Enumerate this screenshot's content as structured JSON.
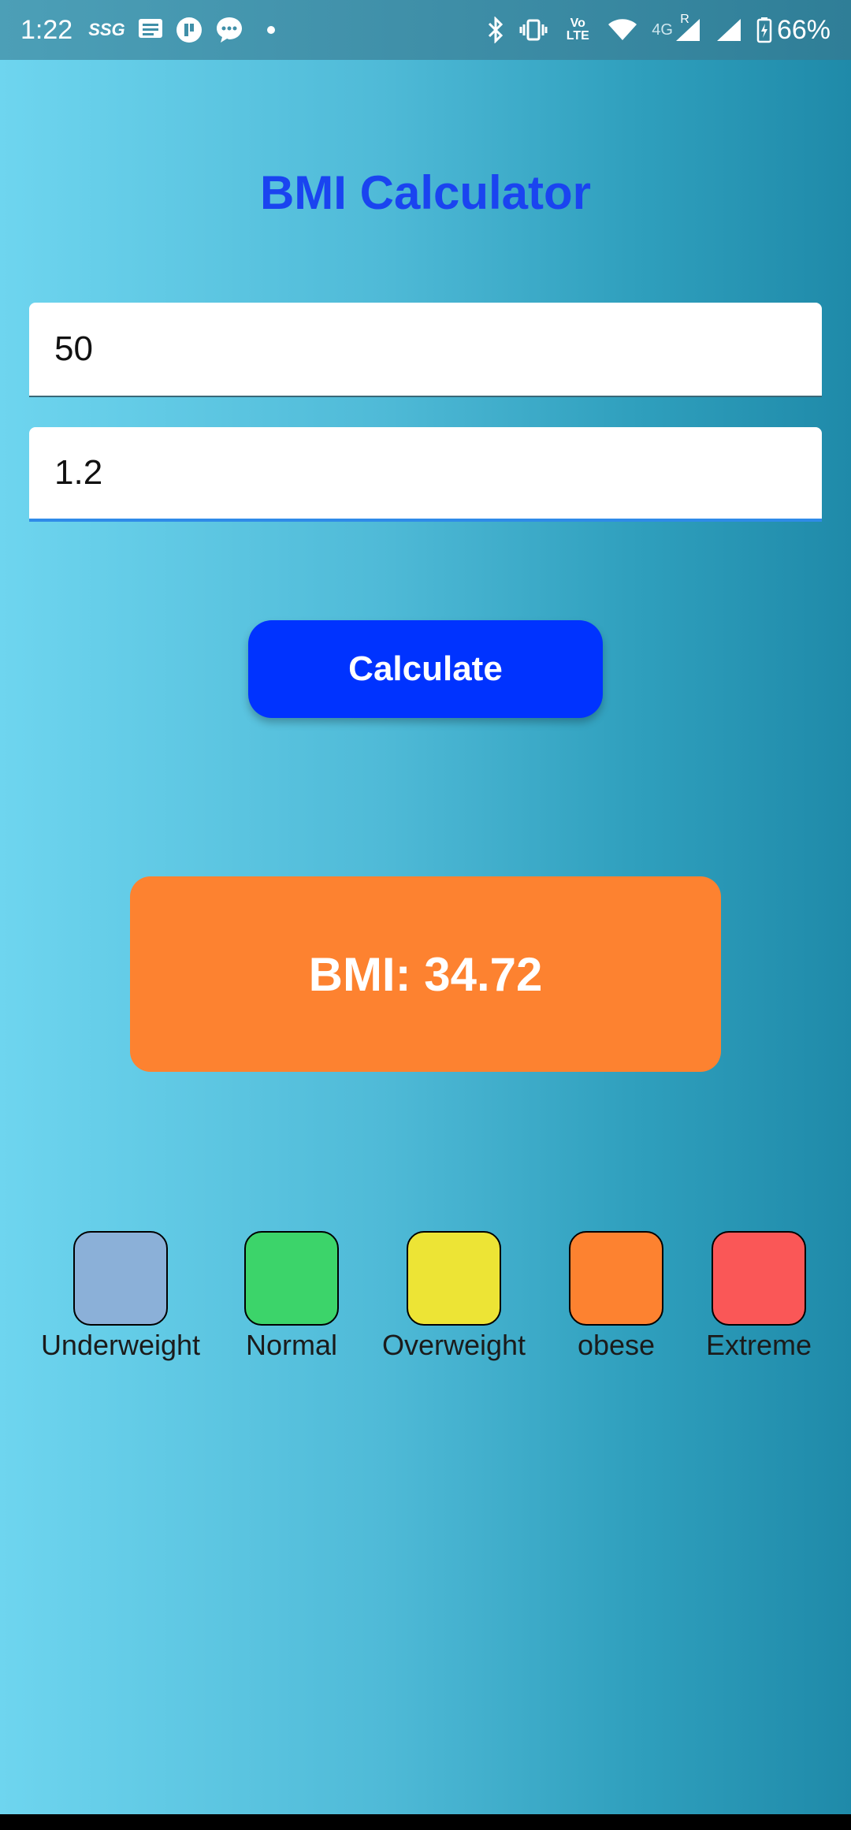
{
  "status_bar": {
    "time": "1:22",
    "notification_icons": [
      "ssg-icon",
      "message-list-icon",
      "app-icon",
      "chat-bubble-icon",
      "dot-icon"
    ],
    "ssg_label": "SSG",
    "network_label": "4G",
    "roaming_label": "R",
    "volte_label": "Vo LTE",
    "battery": "66%"
  },
  "app": {
    "title": "BMI Calculator",
    "title_color": "#1a44f0"
  },
  "inputs": {
    "weight_value": "50",
    "height_value": "1.2"
  },
  "calculate_button": {
    "label": "Calculate",
    "color": "#0033ff"
  },
  "result": {
    "text": "BMI: 34.72",
    "color": "#fd8230"
  },
  "legend": {
    "items": [
      {
        "label": "Underweight",
        "color": "#8bb0d8"
      },
      {
        "label": "Normal",
        "color": "#3cd46a"
      },
      {
        "label": "Overweight",
        "color": "#ede435"
      },
      {
        "label": "obese",
        "color": "#fd8230"
      },
      {
        "label": "Extreme",
        "color": "#fa5757"
      }
    ]
  }
}
